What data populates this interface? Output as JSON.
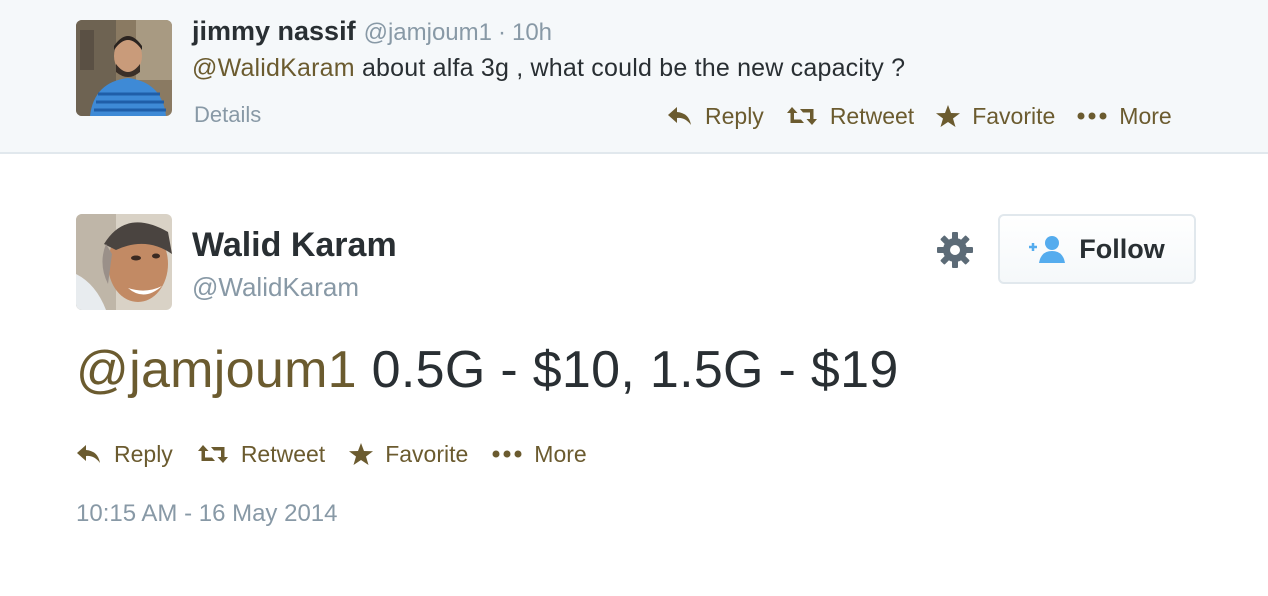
{
  "reply_tweet": {
    "fullname": "jimmy nassif",
    "handle": "@jamjoum1",
    "separator": "·",
    "time": "10h",
    "mention": "@WalidKaram",
    "text": " about alfa 3g , what could be the new capacity ?",
    "details_label": "Details",
    "actions": {
      "reply": "Reply",
      "retweet": "Retweet",
      "favorite": "Favorite",
      "more": "More"
    }
  },
  "main_tweet": {
    "fullname": "Walid Karam",
    "handle": "@WalidKaram",
    "follow_label": "Follow",
    "mention": "@jamjoum1",
    "text": " 0.5G - $10, 1.5G - $19",
    "actions": {
      "reply": "Reply",
      "retweet": "Retweet",
      "favorite": "Favorite",
      "more": "More"
    },
    "timestamp": "10:15 AM - 16 May 2014"
  },
  "icons": {
    "reply": "reply-icon",
    "retweet": "retweet-icon",
    "favorite": "star-icon",
    "more": "ellipsis-icon",
    "settings": "gear-icon",
    "follow": "add-user-icon"
  },
  "colors": {
    "link": "#6b5b2f",
    "text": "#292f33",
    "muted": "#8899a6",
    "reply_bg": "#f5f8fa",
    "follow_icon": "#55acee"
  }
}
